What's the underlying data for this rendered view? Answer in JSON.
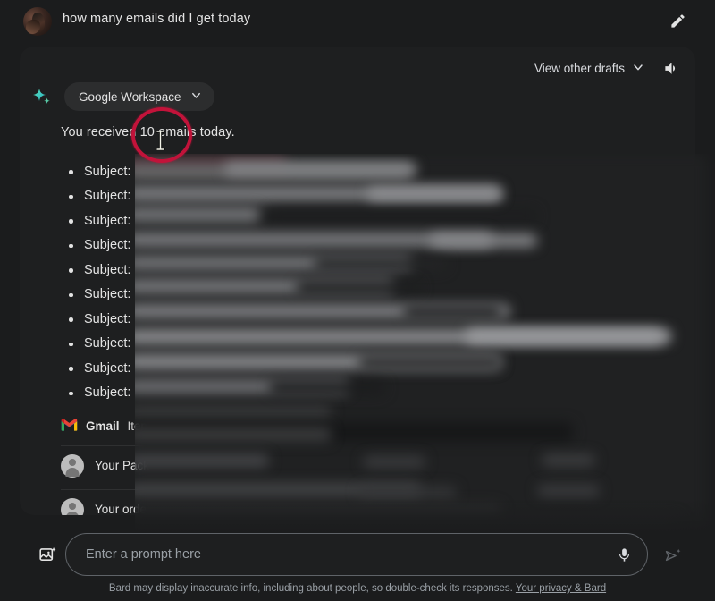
{
  "page": {
    "background": "#1b1c1d",
    "card_background": "#1e1f20"
  },
  "query": {
    "text": "how many emails did I get today",
    "avatar_name": "user-avatar",
    "edit_icon": "pencil-edit-icon"
  },
  "response": {
    "drafts_label": "View other drafts",
    "drafts_chevron_icon": "chevron-down-icon",
    "speaker_icon": "volume-speaker-icon",
    "bard_icon": "bard-sparkle-icon",
    "extension_chip": {
      "label": "Google Workspace",
      "chevron_icon": "chevron-down-icon"
    },
    "answer": "You received 10 emails today.",
    "email_count": 10,
    "bullet_label": "Subject:",
    "bullets": [
      {
        "label": "Subject:",
        "redacted": true
      },
      {
        "label": "Subject:",
        "redacted": true
      },
      {
        "label": "Subject:",
        "redacted": true
      },
      {
        "label": "Subject:",
        "redacted": true
      },
      {
        "label": "Subject:",
        "redacted": true
      },
      {
        "label": "Subject:",
        "redacted": true
      },
      {
        "label": "Subject:",
        "redacted": true
      },
      {
        "label": "Subject:",
        "redacted": true
      },
      {
        "label": "Subject:",
        "redacted": true
      },
      {
        "label": "Subject:",
        "redacted": true
      }
    ]
  },
  "gmail": {
    "logo_icon": "gmail-logo-icon",
    "name": "Gmail",
    "subtitle": "Item",
    "rows": [
      {
        "avatar_icon": "contact-avatar-icon",
        "subject": "Your Pack"
      },
      {
        "avatar_icon": "contact-avatar-icon",
        "subject": "Your orde"
      }
    ]
  },
  "annotation": {
    "circle_color": "#c2133a",
    "cursor_icon": "text-ibeam-cursor"
  },
  "prompt": {
    "image_icon": "add-image-icon",
    "placeholder": "Enter a prompt here",
    "value": "",
    "mic_icon": "microphone-icon",
    "send_icon": "send-sparkle-icon"
  },
  "footer": {
    "disclaimer": "Bard may display inaccurate info, including about people, so double-check its responses.",
    "link": "Your privacy & Bard"
  }
}
